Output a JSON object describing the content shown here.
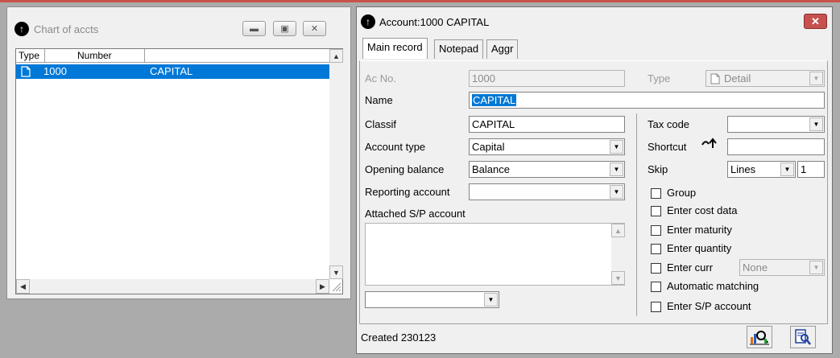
{
  "chart_window": {
    "title": "Chart of accts",
    "icon": "info-circle-icon",
    "columns": [
      "Type",
      "Number"
    ],
    "rows": [
      {
        "type_icon": "document-icon",
        "number": "1000",
        "name": "CAPITAL"
      }
    ]
  },
  "account_window": {
    "title": "Account:1000 CAPITAL",
    "icon": "info-circle-icon",
    "tabs": [
      "Main record",
      "Notepad",
      "Aggr"
    ],
    "active_tab": "Main record",
    "ac_no": {
      "label": "Ac No.",
      "value": "1000"
    },
    "type": {
      "label": "Type",
      "value": "Detail"
    },
    "name": {
      "label": "Name",
      "value": "CAPITAL"
    },
    "classif": {
      "label": "Classif",
      "value": "CAPITAL"
    },
    "account_type": {
      "label": "Account type",
      "value": "Capital"
    },
    "opening_balance": {
      "label": "Opening balance",
      "value": "Balance"
    },
    "reporting_account": {
      "label": "Reporting account",
      "value": ""
    },
    "attached_sp": {
      "label": "Attached S/P account",
      "value": ""
    },
    "tax_code": {
      "label": "Tax code",
      "value": ""
    },
    "shortcut": {
      "label": "Shortcut",
      "value": ""
    },
    "skip": {
      "label": "Skip",
      "unit": "Lines",
      "count": "1"
    },
    "checkboxes": [
      {
        "label": "Group",
        "checked": false
      },
      {
        "label": "Enter cost data",
        "checked": false
      },
      {
        "label": "Enter maturity",
        "checked": false
      },
      {
        "label": "Enter quantity",
        "checked": false
      },
      {
        "label": "Enter curr",
        "checked": false
      },
      {
        "label": "Automatic matching",
        "checked": false
      },
      {
        "label": "Enter S/P account",
        "checked": false
      }
    ],
    "currency": {
      "value": "None"
    },
    "status_text": "Created 230123"
  },
  "colors": {
    "selection": "#0078d7",
    "close_button": "#c75050",
    "top_border": "#c9534a"
  }
}
